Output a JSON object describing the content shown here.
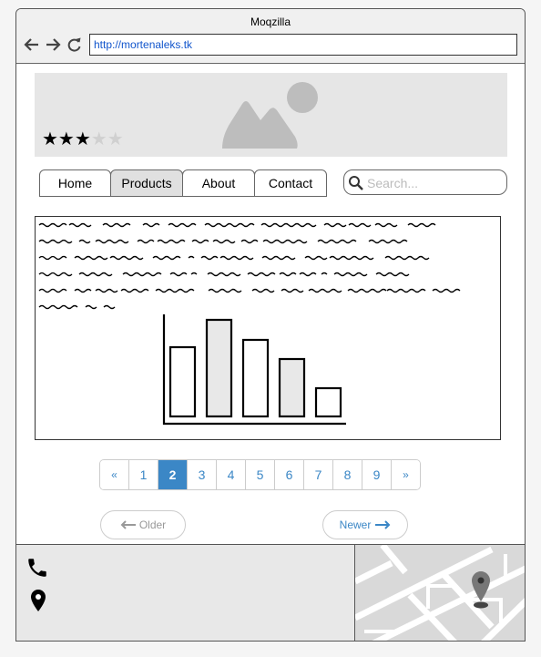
{
  "browser": {
    "title": "Moqzilla",
    "url": "http://mortenaleks.tk",
    "icons": [
      "back-arrow-icon",
      "forward-arrow-icon",
      "reload-icon"
    ]
  },
  "hero": {
    "icon": "image-placeholder-icon",
    "rating": {
      "value": 3,
      "max": 5
    },
    "rating_stars_on": "★★★",
    "rating_stars_off": "★★"
  },
  "nav": {
    "items": [
      {
        "label": "Home",
        "active": false
      },
      {
        "label": "Products",
        "active": true
      },
      {
        "label": "About",
        "active": false
      },
      {
        "label": "Contact",
        "active": false
      }
    ]
  },
  "search": {
    "placeholder": "Search...",
    "icon": "search-icon"
  },
  "content": {
    "text_icon": "scribble-text-placeholder",
    "chart_icon": "bar-chart-placeholder-icon"
  },
  "pagination": {
    "prev": "«",
    "next": "»",
    "pages": [
      "1",
      "2",
      "3",
      "4",
      "5",
      "6",
      "7",
      "8",
      "9"
    ],
    "current": "2"
  },
  "pager_links": {
    "older": "Older",
    "newer": "Newer"
  },
  "footer": {
    "icons": [
      "phone-icon",
      "location-pin-icon",
      "map-icon",
      "map-pin-icon"
    ]
  },
  "colors": {
    "accent": "#3b87c6",
    "link": "#1155cc",
    "placeholder_bg": "#e6e6e6"
  }
}
